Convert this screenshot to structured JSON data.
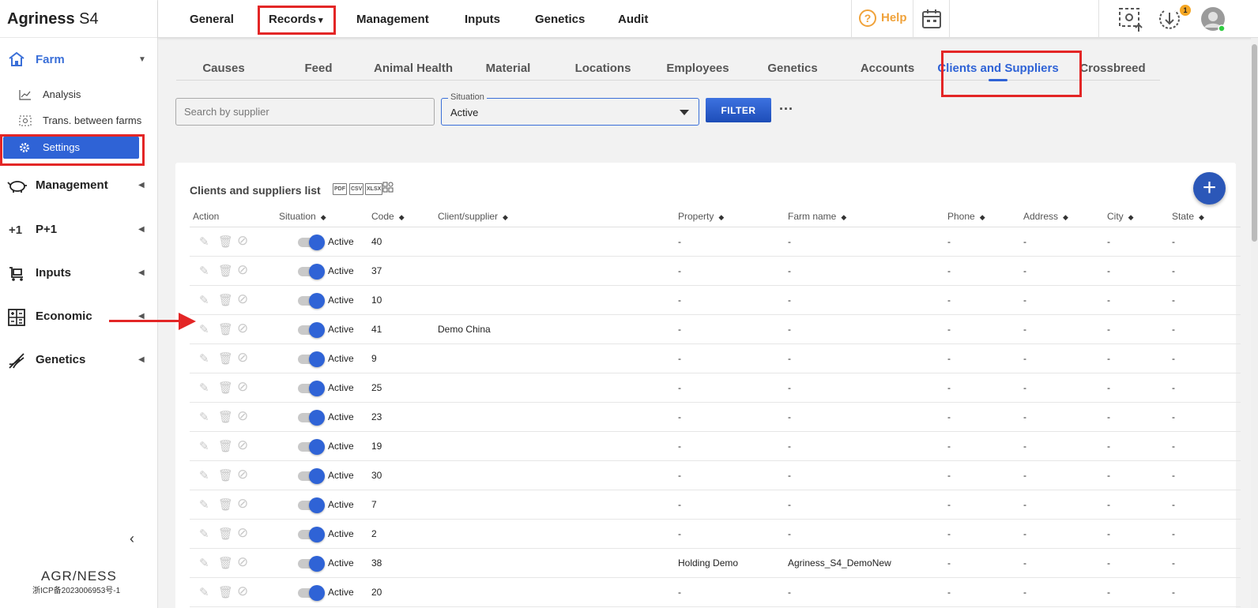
{
  "app": {
    "name": "Agriness",
    "version": "S4"
  },
  "sidebar": {
    "farm_label": "Farm",
    "sub_items": [
      {
        "label": "Analysis"
      },
      {
        "label": "Trans. between farms"
      },
      {
        "label": "Settings"
      }
    ],
    "modules": [
      {
        "label": "Management"
      },
      {
        "label": "P+1"
      },
      {
        "label": "Inputs"
      },
      {
        "label": "Economic"
      },
      {
        "label": "Genetics"
      }
    ],
    "brand": "AGR/NESS",
    "icp": "浙ICP备2023006953号-1"
  },
  "topnav": {
    "items": [
      "General",
      "Records",
      "Management",
      "Inputs",
      "Genetics",
      "Audit"
    ],
    "records_caret": "▾",
    "help": "Help",
    "notification_count": "1"
  },
  "tabs": [
    "Causes",
    "Feed",
    "Animal Health",
    "Material",
    "Locations",
    "Employees",
    "Genetics",
    "Accounts",
    "Clients and Suppliers",
    "Crossbreed"
  ],
  "active_tab": "Clients and Suppliers",
  "filters": {
    "search_placeholder": "Search by supplier",
    "situation_label": "Situation",
    "situation_value": "Active",
    "filter_button": "FILTER",
    "more": "···"
  },
  "list": {
    "title": "Clients and suppliers list",
    "exports": [
      "PDF",
      "CSV",
      "XLSX"
    ],
    "columns": [
      "Action",
      "Situation",
      "Code",
      "Client/supplier",
      "Property",
      "Farm name",
      "Phone",
      "Address",
      "City",
      "State"
    ],
    "rows": [
      {
        "situation": "Active",
        "code": "40",
        "client": "",
        "property": "-",
        "farm": "-",
        "phone": "-",
        "address": "-",
        "city": "-",
        "state": "-"
      },
      {
        "situation": "Active",
        "code": "37",
        "client": "",
        "property": "-",
        "farm": "-",
        "phone": "-",
        "address": "-",
        "city": "-",
        "state": "-"
      },
      {
        "situation": "Active",
        "code": "10",
        "client": "",
        "property": "-",
        "farm": "-",
        "phone": "-",
        "address": "-",
        "city": "-",
        "state": "-"
      },
      {
        "situation": "Active",
        "code": "41",
        "client": "Demo China",
        "property": "-",
        "farm": "-",
        "phone": "-",
        "address": "-",
        "city": "-",
        "state": "-"
      },
      {
        "situation": "Active",
        "code": "9",
        "client": "",
        "property": "-",
        "farm": "-",
        "phone": "-",
        "address": "-",
        "city": "-",
        "state": "-"
      },
      {
        "situation": "Active",
        "code": "25",
        "client": "",
        "property": "-",
        "farm": "-",
        "phone": "-",
        "address": "-",
        "city": "-",
        "state": "-"
      },
      {
        "situation": "Active",
        "code": "23",
        "client": "",
        "property": "-",
        "farm": "-",
        "phone": "-",
        "address": "-",
        "city": "-",
        "state": "-"
      },
      {
        "situation": "Active",
        "code": "19",
        "client": "",
        "property": "-",
        "farm": "-",
        "phone": "-",
        "address": "-",
        "city": "-",
        "state": "-"
      },
      {
        "situation": "Active",
        "code": "30",
        "client": "",
        "property": "-",
        "farm": "-",
        "phone": "-",
        "address": "-",
        "city": "-",
        "state": "-"
      },
      {
        "situation": "Active",
        "code": "7",
        "client": "",
        "property": "-",
        "farm": "-",
        "phone": "-",
        "address": "-",
        "city": "-",
        "state": "-"
      },
      {
        "situation": "Active",
        "code": "2",
        "client": "",
        "property": "-",
        "farm": "-",
        "phone": "-",
        "address": "-",
        "city": "-",
        "state": "-"
      },
      {
        "situation": "Active",
        "code": "38",
        "client": "",
        "property": "Holding Demo",
        "farm": "Agriness_S4_DemoNew",
        "phone": "-",
        "address": "-",
        "city": "-",
        "state": "-"
      },
      {
        "situation": "Active",
        "code": "20",
        "client": "",
        "property": "-",
        "farm": "-",
        "phone": "-",
        "address": "-",
        "city": "-",
        "state": "-"
      }
    ]
  },
  "colors": {
    "accent": "#2f63d6",
    "help": "#f0a23a",
    "annotation": "#e32626"
  }
}
